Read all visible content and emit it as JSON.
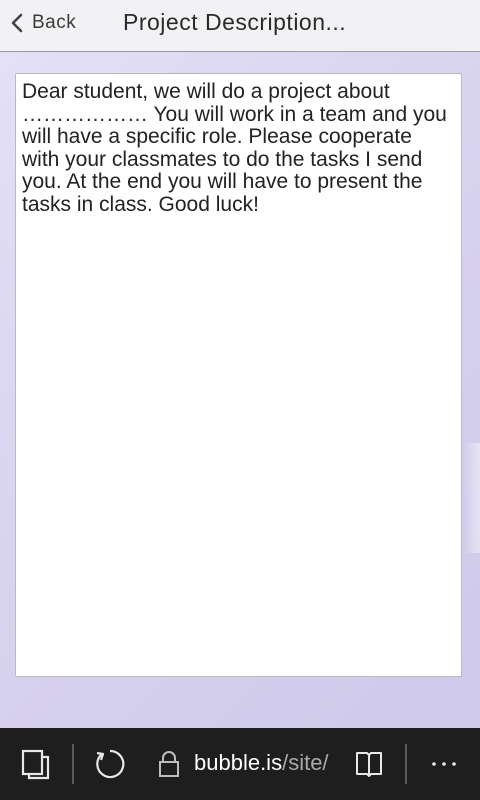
{
  "header": {
    "back_label": "Back",
    "title": "Project Description..."
  },
  "content": {
    "text": "Dear student, we will do a project about ……………… You will work in a team and you will have a specific role. Please cooperate with your classmates to do the tasks I send you. At the end you will have to present the tasks in class. Good luck!"
  },
  "toolbar": {
    "url_domain": "bubble.is",
    "url_path": "/site/",
    "icons": [
      "tabs-icon",
      "refresh-icon",
      "lock-icon",
      "reading-view-icon",
      "more-icon"
    ]
  },
  "colors": {
    "header_bg": "#f2f1f4",
    "content_bg": "#dcd8f0",
    "toolbar_bg": "#1e1e1e"
  }
}
